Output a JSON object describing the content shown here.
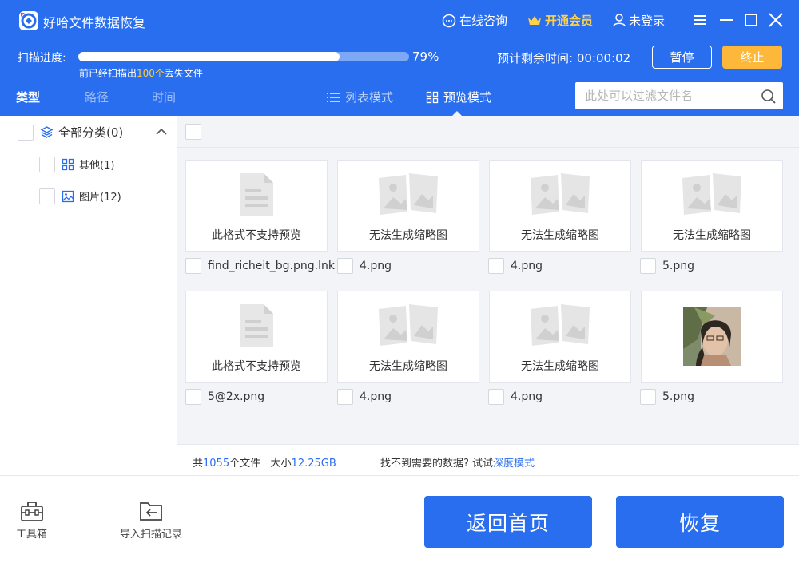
{
  "app": {
    "title": "好哈文件数据恢复"
  },
  "top_actions": {
    "consult": "在线咨询",
    "vip": "开通会员",
    "login": "未登录"
  },
  "scan": {
    "label": "扫描进度:",
    "progress": 0.79,
    "percent_text": "79%",
    "sub_prefix": "前已经扫描出",
    "sub_count": "100个",
    "sub_suffix": "丢失文件",
    "remaining_label": "预计剩余时间:",
    "remaining_time": "00:00:02",
    "pause": "暂停",
    "stop": "终止"
  },
  "tabs": {
    "type": "类型",
    "path": "路径",
    "time": "时间"
  },
  "views": {
    "list": "列表模式",
    "preview": "预览模式"
  },
  "filter": {
    "placeholder": "此处可以过滤文件名"
  },
  "sidebar": {
    "root": "全部分类(0)",
    "items": [
      {
        "label": "其他(1)",
        "icon": "grid-icon"
      },
      {
        "label": "图片(12)",
        "icon": "image-icon"
      }
    ]
  },
  "files": [
    {
      "caption": "此格式不支持预览",
      "name": "find_richeit_bg.png.lnk",
      "thumb": "document"
    },
    {
      "caption": "无法生成缩略图",
      "name": "4.png",
      "thumb": "broken-image"
    },
    {
      "caption": "无法生成缩略图",
      "name": "4.png",
      "thumb": "broken-image"
    },
    {
      "caption": "无法生成缩略图",
      "name": "5.png",
      "thumb": "broken-image"
    },
    {
      "caption": "此格式不支持预览",
      "name": "5@2x.png",
      "thumb": "document"
    },
    {
      "caption": "无法生成缩略图",
      "name": "4.png",
      "thumb": "broken-image"
    },
    {
      "caption": "无法生成缩略图",
      "name": "4.png",
      "thumb": "broken-image"
    },
    {
      "caption": "",
      "name": "5.png",
      "thumb": "photo"
    }
  ],
  "status": {
    "total_prefix": "共",
    "total_count": "1055",
    "total_suffix": "个文件",
    "size_label": "大小",
    "size_value": "12.25GB",
    "hint": "找不到需要的数据? 试试",
    "deep_mode": "深度模式"
  },
  "footer": {
    "toolbox": "工具箱",
    "import": "导入扫描记录",
    "home": "返回首页",
    "recover": "恢复"
  },
  "colors": {
    "primary": "#2a6ef0",
    "accent": "#fdb83c",
    "vip": "#ffd24a",
    "panel_bg": "#f2f4f8"
  }
}
